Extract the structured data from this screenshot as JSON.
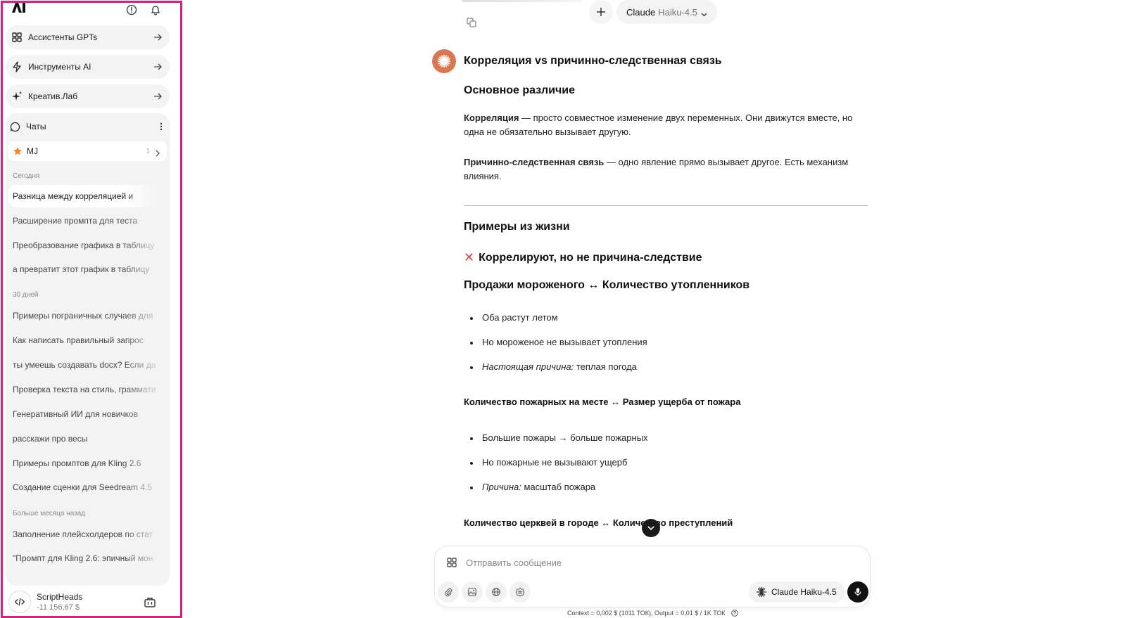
{
  "sidebar": {
    "nav": [
      {
        "label": "Ассистенты GPTs",
        "icon": "grid-icon"
      },
      {
        "label": "Инструменты AI",
        "icon": "bolt-icon"
      },
      {
        "label": "Креатив.Лаб",
        "icon": "sparkle-icon"
      }
    ],
    "chats_label": "Чаты",
    "pinned": {
      "label": "MJ",
      "count": "1"
    },
    "groups": [
      {
        "label": "Сегодня",
        "items": [
          "Разница между корреляцией и",
          "Расширение промпта для теста",
          "Преобразование графика в таблицу",
          "а превратит этот график в таблицу"
        ]
      },
      {
        "label": "30 дней",
        "items": [
          "Примеры пограничных случаев для",
          "Как написать правильный запрос",
          "ты умеешь создавать docx? Если да",
          "Проверка текста на стиль, граммати",
          "Генеративный ИИ для новичков",
          "расскажи про весы",
          "Примеры промптов для Kling 2.6",
          "Создание сценки для Seedream 4.5"
        ]
      },
      {
        "label": "Больше месяца назад",
        "items": [
          "Заполнение плейсхолдеров по стат",
          "\"Промпт для Kling 2.6: эпичный мон"
        ]
      }
    ],
    "user": {
      "name": "ScriptHeads",
      "balance": "-11 156,67 $"
    }
  },
  "topbar": {
    "model_brand": "Claude",
    "model_variant": "Haiku-4.5"
  },
  "message": {
    "title": "Корреляция vs причинно-следственная связь",
    "section1": "Основное различие",
    "corr_term": "Корреляция",
    "corr_text": " — просто совместное изменение двух переменных. Они движутся вместе, но одна не обязательно вызывает другую.",
    "cause_term": "Причинно-следственная связь",
    "cause_text": " — одно явление прямо вызывает другое. Есть механизм влияния.",
    "section2": "Примеры из жизни",
    "section3": "Коррелируют, но не причина-следствие",
    "ex1_title": "Продажи мороженого ↔ Количество утопленников",
    "ex1_b1": "Оба растут летом",
    "ex1_b2": "Но мороженое не вызывает утопления",
    "ex1_b3_em": "Настоящая причина:",
    "ex1_b3": " теплая погода",
    "ex2_title": "Количество пожарных на месте ↔ Размер ущерба от пожара",
    "ex2_b1": "Большие пожары → больше пожарных",
    "ex2_b2": "Но пожарные не вызывают ущерб",
    "ex2_b3_em": "Причина:",
    "ex2_b3": " масштаб пожара",
    "ex3_title": "Количество церквей в городе ↔ Количество преступлений"
  },
  "composer": {
    "placeholder": "Отправить сообщение",
    "model_label": "Claude Haiku-4.5",
    "footer": "Context = 0,002 $ (1011 ТОК), Output = 0,01 $ / 1K ТОК"
  },
  "colors": {
    "accent": "#d4237a",
    "claude_orange": "#d97755",
    "cross_red": "#e0424b"
  }
}
